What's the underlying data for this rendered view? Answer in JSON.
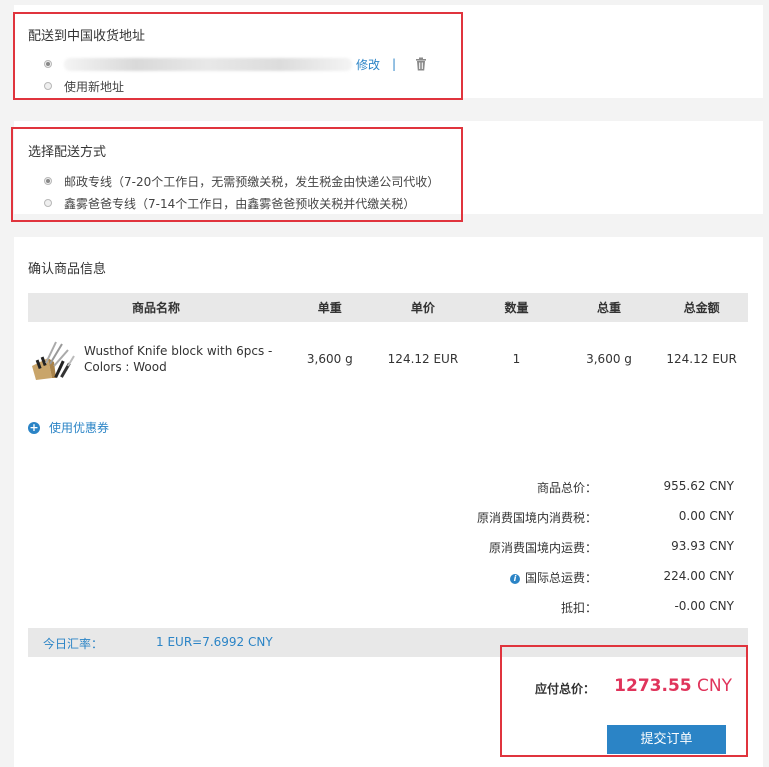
{
  "address": {
    "title": "配送到中国收货地址",
    "edit_label": "修改",
    "divider": "|",
    "new_address_label": "使用新地址"
  },
  "shipping": {
    "title": "选择配送方式",
    "options": [
      {
        "label": "邮政专线（7-20个工作日，无需预缴关税，发生税金由快递公司代收）",
        "selected": true
      },
      {
        "label": "鑫雾爸爸专线（7-14个工作日，由鑫雾爸爸预收关税并代缴关税）",
        "selected": false
      }
    ]
  },
  "goods": {
    "title": "确认商品信息",
    "columns": [
      "商品名称",
      "单重",
      "单价",
      "数量",
      "总重",
      "总金额"
    ],
    "rows": [
      {
        "name": "Wusthof Knife block with 6pcs - Colors : Wood",
        "unit_weight": "3,600 g",
        "unit_price": "124.12 EUR",
        "qty": "1",
        "total_weight": "3,600 g",
        "total_amount": "124.12 EUR"
      }
    ],
    "coupon_label": "使用优惠券"
  },
  "summary": {
    "items_label": "商品总价：",
    "items_value": "955.62 CNY",
    "consumption_tax_label": "原消费国境内消费税：",
    "consumption_tax_value": "0.00 CNY",
    "domestic_freight_label": "原消费国境内运费：",
    "domestic_freight_value": "93.93 CNY",
    "intl_freight_label": "国际总运费：",
    "intl_freight_value": "224.00 CNY",
    "discount_label": "抵扣：",
    "discount_value": "-0.00 CNY"
  },
  "rate": {
    "label": "今日汇率：",
    "value": "1 EUR=7.6992 CNY"
  },
  "total": {
    "label": "应付总价：",
    "amount": "1273.55",
    "currency": "CNY"
  },
  "submit_label": "提交订单",
  "colors": {
    "accent_blue": "#2b84c6",
    "highlight_red": "#e0343d",
    "price_pink": "#e0345b"
  }
}
